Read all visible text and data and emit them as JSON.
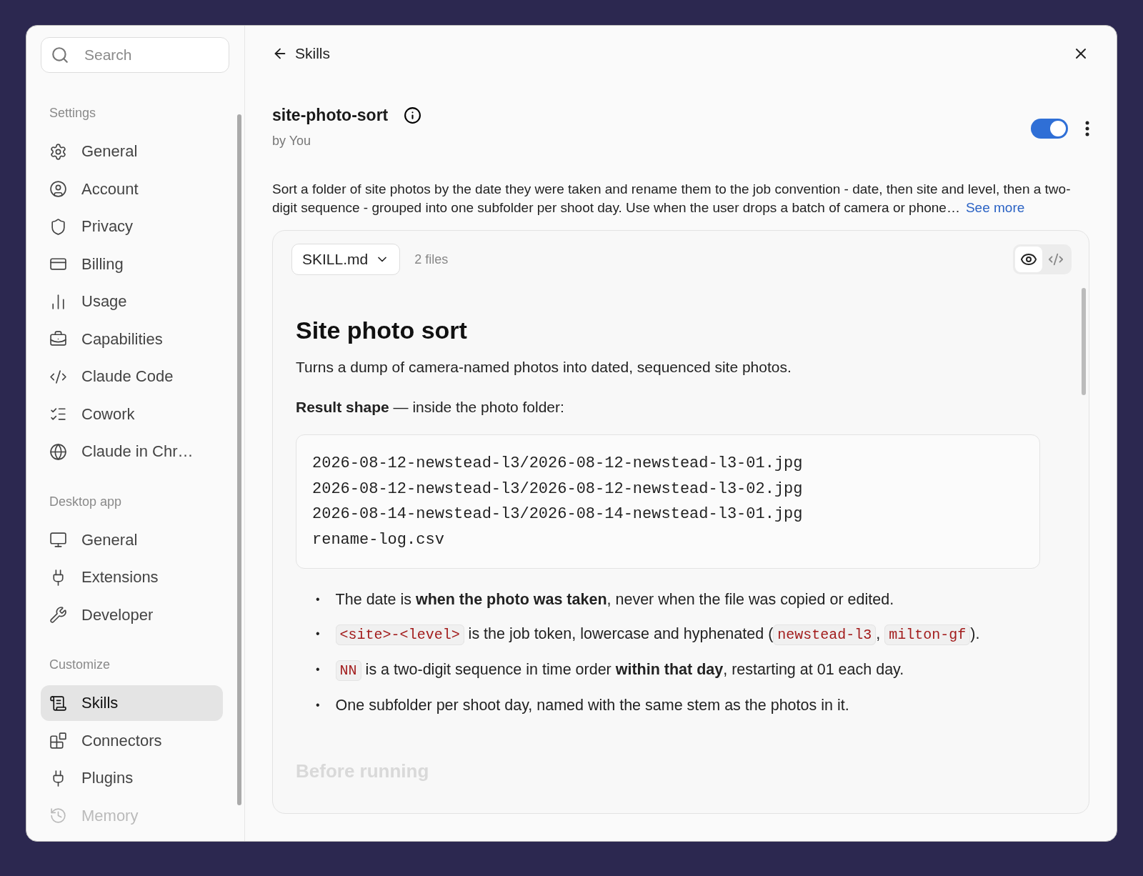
{
  "sidebar": {
    "search": {
      "placeholder": "Search"
    },
    "sections": [
      {
        "title": "Settings",
        "items": [
          {
            "label": "General",
            "selected": false
          },
          {
            "label": "Account",
            "selected": false
          },
          {
            "label": "Privacy",
            "selected": false
          },
          {
            "label": "Billing",
            "selected": false
          },
          {
            "label": "Usage",
            "selected": false
          },
          {
            "label": "Capabilities",
            "selected": false
          },
          {
            "label": "Claude Code",
            "selected": false
          },
          {
            "label": "Cowork",
            "selected": false
          },
          {
            "label": "Claude in Chr…",
            "selected": false
          }
        ]
      },
      {
        "title": "Desktop app",
        "items": [
          {
            "label": "General",
            "selected": false
          },
          {
            "label": "Extensions",
            "selected": false
          },
          {
            "label": "Developer",
            "selected": false
          }
        ]
      },
      {
        "title": "Customize",
        "items": [
          {
            "label": "Skills",
            "selected": true
          },
          {
            "label": "Connectors",
            "selected": false
          },
          {
            "label": "Plugins",
            "selected": false
          },
          {
            "label": "Memory",
            "selected": false
          }
        ]
      }
    ]
  },
  "header": {
    "back_label": "Skills"
  },
  "skill": {
    "name": "site-photo-sort",
    "author": "by You",
    "enabled": true,
    "description": "Sort a folder of site photos by the date they were taken and rename them to the job convention - date, then site and level, then a two-digit sequence - grouped into one subfolder per shoot day. Use when the user drops a batch of camera or phone…",
    "see_more": "See more"
  },
  "viewer": {
    "file": "SKILL.md",
    "file_count": "2 files",
    "view_buttons": [
      {
        "kind": "preview",
        "selected": true
      },
      {
        "kind": "source",
        "selected": false
      }
    ],
    "document": {
      "heading": "Site photo sort",
      "intro": "Turns a dump of camera-named photos into dated, sequenced site photos.",
      "result_line": "**Result shape** — inside the photo folder:",
      "code_lines": [
        "2026-08-12-newstead-l3/2026-08-12-newstead-l3-01.jpg",
        "2026-08-12-newstead-l3/2026-08-12-newstead-l3-02.jpg",
        "2026-08-14-newstead-l3/2026-08-14-newstead-l3-01.jpg",
        "rename-log.csv"
      ],
      "bullets": [
        {
          "marker": "•",
          "parts": [
            {
              "kind": "text",
              "text": "The date is **when the photo was taken**, never when the file was copied or edited."
            }
          ]
        },
        {
          "marker": "•",
          "parts": [
            {
              "kind": "code",
              "text": "<site>-<level>"
            },
            {
              "kind": "text",
              "text": " is the job token, lowercase and hyphenated ("
            },
            {
              "kind": "code",
              "text": "newstead-l3"
            },
            {
              "kind": "text",
              "text": ", "
            },
            {
              "kind": "code",
              "text": "milton-gf"
            },
            {
              "kind": "text",
              "text": ")."
            }
          ]
        },
        {
          "marker": "•",
          "parts": [
            {
              "kind": "code",
              "text": "NN"
            },
            {
              "kind": "text",
              "text": " is a two-digit sequence in time order **within that day**, restarting at 01 each day."
            }
          ]
        },
        {
          "marker": "•",
          "parts": [
            {
              "kind": "text",
              "text": "One subfolder per shoot day, named with the same stem as the photos in it."
            }
          ]
        }
      ],
      "next_heading": "Before running"
    }
  }
}
